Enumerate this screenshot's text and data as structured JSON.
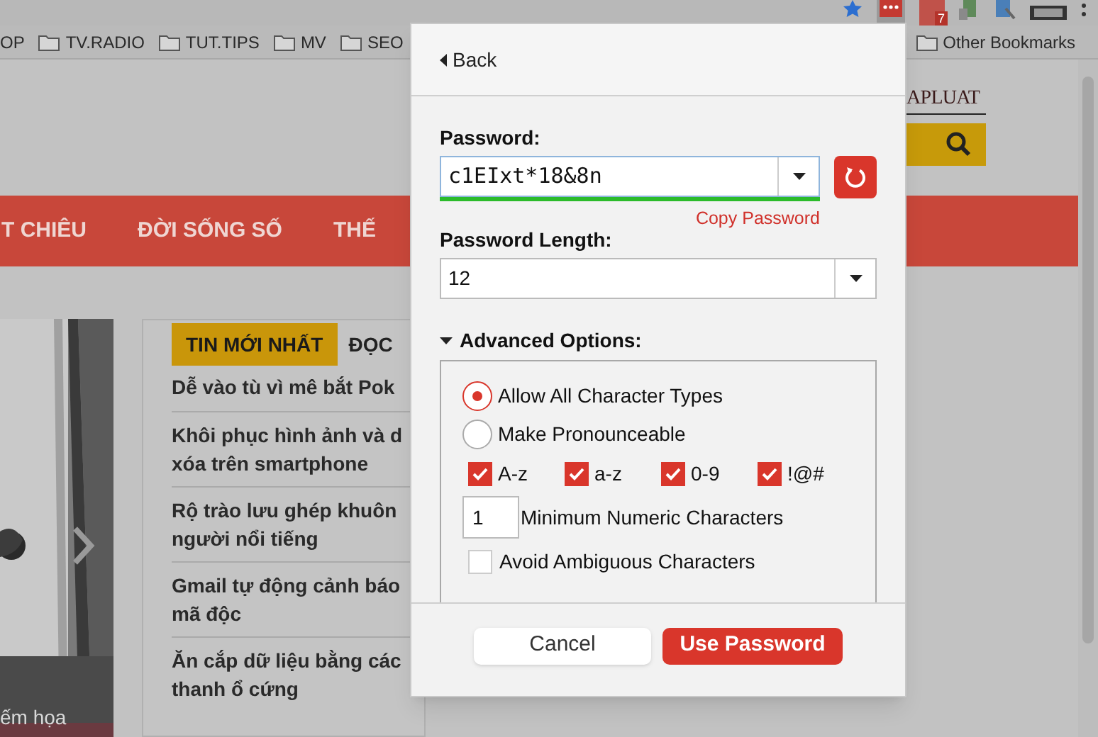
{
  "browser": {
    "bookmarks": [
      "OP",
      "TV.RADIO",
      "TUT.TIPS",
      "MV",
      "SEO"
    ],
    "other_bookmarks": "Other Bookmarks",
    "extension_badge": "7"
  },
  "page": {
    "logo": "APLUAT",
    "nav": [
      "T CHIÊU",
      "ĐỜI SỐNG SỐ",
      "THẾ"
    ],
    "photo_caption": "ếm họa",
    "news_tabs": [
      {
        "label": "TIN MỚI NHẤT",
        "selected": true
      },
      {
        "label": "ĐỌC",
        "selected": false
      }
    ],
    "news": [
      [
        "Dễ vào tù vì mê bắt Pok"
      ],
      [
        "Khôi phục hình ảnh và d",
        "xóa trên smartphone"
      ],
      [
        "Rộ trào lưu ghép khuôn",
        "người nổi tiếng"
      ],
      [
        "Gmail tự động cảnh báo",
        "mã độc"
      ],
      [
        "Ăn cắp dữ liệu bằng các",
        "thanh ổ cứng"
      ]
    ]
  },
  "popup": {
    "back": "Back",
    "password_label": "Password:",
    "password": "c1EIxt*18&8n",
    "strength": {
      "level": 1
    },
    "copy_link": "Copy Password",
    "length_label": "Password Length:",
    "length": "12",
    "advanced": {
      "label": "Advanced Options:",
      "expanded": true,
      "modes": [
        {
          "label": "Allow All Character Types",
          "selected": true
        },
        {
          "label": "Make Pronounceable",
          "selected": false
        }
      ],
      "charsets": [
        {
          "label": "A-z",
          "checked": true
        },
        {
          "label": "a-z",
          "checked": true
        },
        {
          "label": "0-9",
          "checked": true
        },
        {
          "label": "!@#",
          "checked": true
        }
      ],
      "min_numeric": {
        "value": "1",
        "label": "Minimum Numeric Characters"
      },
      "avoid_ambiguous": {
        "label": "Avoid Ambiguous Characters",
        "checked": false
      }
    },
    "buttons": [
      {
        "label": "Cancel",
        "kind": "secondary"
      },
      {
        "label": "Use Password",
        "kind": "primary"
      }
    ]
  }
}
